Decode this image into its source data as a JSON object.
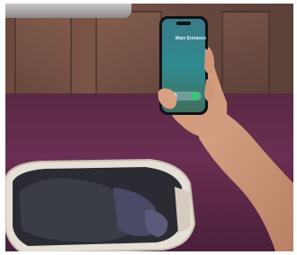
{
  "phone": {
    "caller_name": "Main Entrance",
    "caller_subtitle": "",
    "slider_label": ""
  },
  "colors": {
    "floor": "#5a2a44",
    "wall": "#6b4a3e",
    "phone_screen": "#2f8a8f",
    "skin": "#d9a487",
    "basket": "#e6dfd6"
  }
}
